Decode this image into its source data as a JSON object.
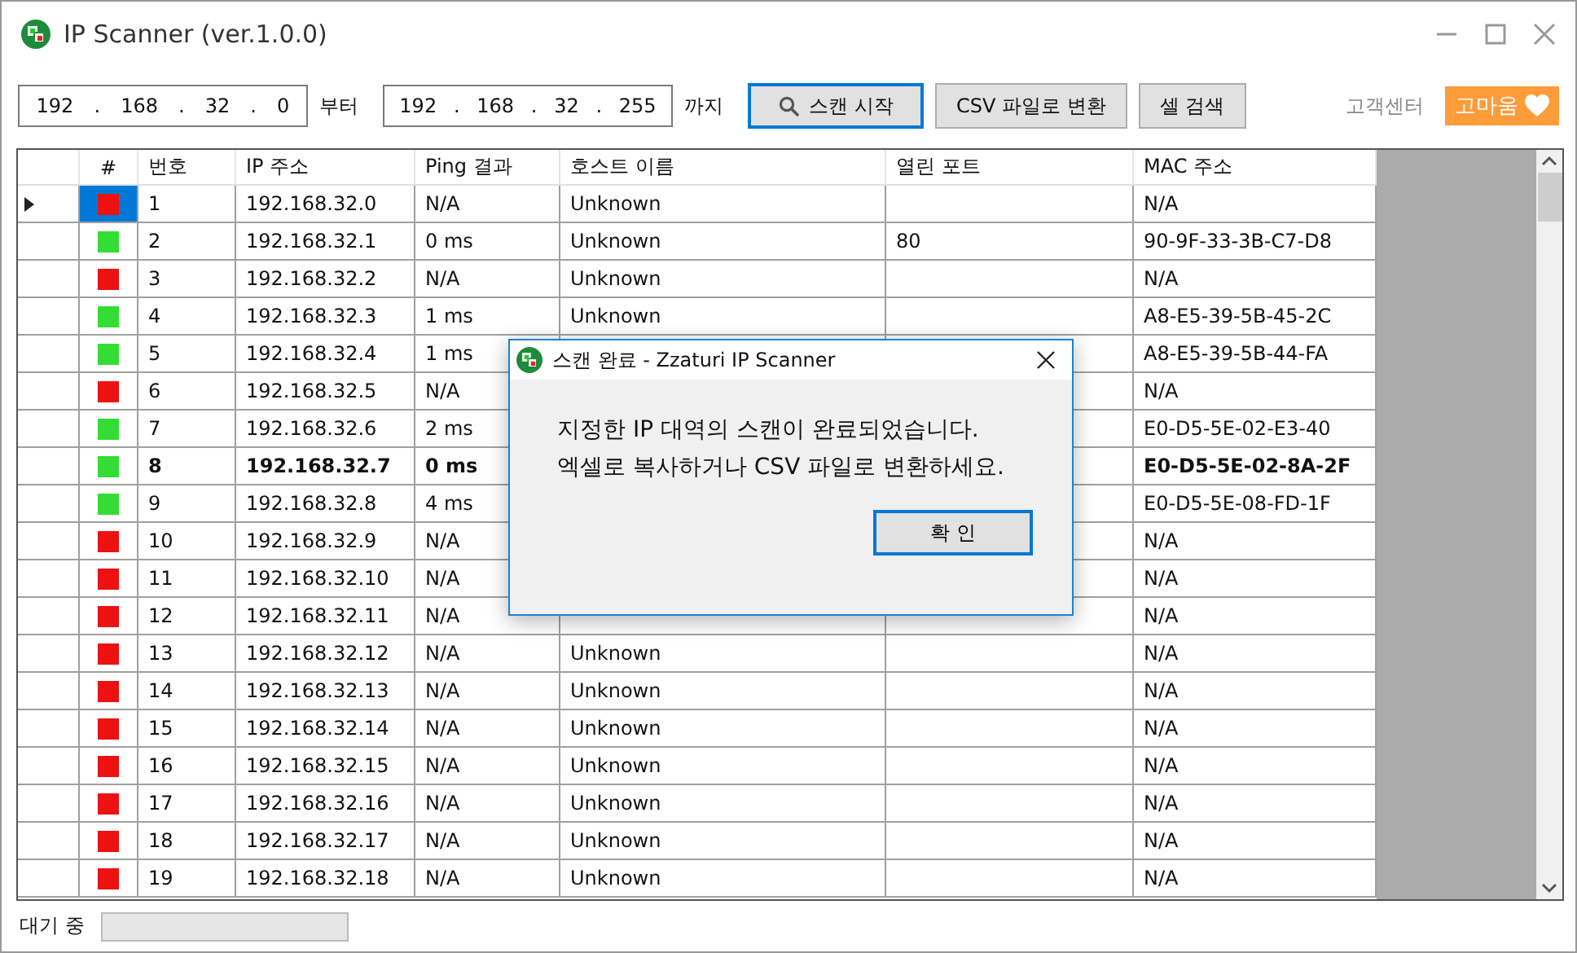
{
  "window": {
    "title": "IP Scanner (ver.1.0.0)"
  },
  "toolbar": {
    "range_start": {
      "octets": [
        "192",
        "168",
        "32",
        "0"
      ],
      "separator": "."
    },
    "start_suffix": "부터",
    "range_end": {
      "octets": [
        "192",
        "168",
        "32",
        "255"
      ],
      "separator": "."
    },
    "end_suffix": "까지",
    "buttons": [
      {
        "label": "스캔 시작",
        "kind": "search",
        "focused": true
      },
      {
        "label": "CSV 파일로 변환",
        "kind": "plain",
        "focused": false
      },
      {
        "label": "셀 검색",
        "kind": "plain",
        "focused": false
      }
    ],
    "support_link": "고객센터",
    "thanks_button": "고마움"
  },
  "table": {
    "columns": [
      "#",
      "번호",
      "IP 주소",
      "Ping 결과",
      "호스트 이름",
      "열린 포트",
      "MAC 주소"
    ],
    "rows": [
      {
        "selected": true,
        "bold": false,
        "color": "#ee1111",
        "number": "1",
        "ip": "192.168.32.0",
        "ping": "N/A",
        "host": "Unknown",
        "mac": "N/A"
      },
      {
        "selected": false,
        "bold": false,
        "color": "#33dd33",
        "number": "2",
        "ip": "192.168.32.1",
        "ping": "0 ms",
        "host": "Unknown",
        "port": "80",
        "mac": "90-9F-33-3B-C7-D8"
      },
      {
        "selected": false,
        "bold": false,
        "color": "#ee1111",
        "number": "3",
        "ip": "192.168.32.2",
        "ping": "N/A",
        "host": "Unknown",
        "mac": "N/A"
      },
      {
        "selected": false,
        "bold": false,
        "color": "#33dd33",
        "number": "4",
        "ip": "192.168.32.3",
        "ping": "1 ms",
        "host": "Unknown",
        "mac": "A8-E5-39-5B-45-2C"
      },
      {
        "selected": false,
        "bold": false,
        "color": "#33dd33",
        "number": "5",
        "ip": "192.168.32.4",
        "ping": "1 ms",
        "mac": "A8-E5-39-5B-44-FA"
      },
      {
        "selected": false,
        "bold": false,
        "color": "#ee1111",
        "number": "6",
        "ip": "192.168.32.5",
        "ping": "N/A",
        "mac": "N/A"
      },
      {
        "selected": false,
        "bold": false,
        "color": "#33dd33",
        "number": "7",
        "ip": "192.168.32.6",
        "ping": "2 ms",
        "mac": "E0-D5-5E-02-E3-40"
      },
      {
        "selected": false,
        "bold": true,
        "color": "#33dd33",
        "number": "8",
        "ip": "192.168.32.7",
        "ping": "0 ms",
        "mac": "E0-D5-5E-02-8A-2F"
      },
      {
        "selected": false,
        "bold": false,
        "color": "#33dd33",
        "number": "9",
        "ip": "192.168.32.8",
        "ping": "4 ms",
        "mac": "E0-D5-5E-08-FD-1F"
      },
      {
        "selected": false,
        "bold": false,
        "color": "#ee1111",
        "number": "10",
        "ip": "192.168.32.9",
        "ping": "N/A",
        "mac": "N/A"
      },
      {
        "selected": false,
        "bold": false,
        "color": "#ee1111",
        "number": "11",
        "ip": "192.168.32.10",
        "ping": "N/A",
        "mac": "N/A"
      },
      {
        "selected": false,
        "bold": false,
        "color": "#ee1111",
        "number": "12",
        "ip": "192.168.32.11",
        "ping": "N/A",
        "mac": "N/A"
      },
      {
        "selected": false,
        "bold": false,
        "color": "#ee1111",
        "number": "13",
        "ip": "192.168.32.12",
        "ping": "N/A",
        "host": "Unknown",
        "mac": "N/A"
      },
      {
        "selected": false,
        "bold": false,
        "color": "#ee1111",
        "number": "14",
        "ip": "192.168.32.13",
        "ping": "N/A",
        "host": "Unknown",
        "mac": "N/A"
      },
      {
        "selected": false,
        "bold": false,
        "color": "#ee1111",
        "number": "15",
        "ip": "192.168.32.14",
        "ping": "N/A",
        "host": "Unknown",
        "mac": "N/A"
      },
      {
        "selected": false,
        "bold": false,
        "color": "#ee1111",
        "number": "16",
        "ip": "192.168.32.15",
        "ping": "N/A",
        "host": "Unknown",
        "mac": "N/A"
      },
      {
        "selected": false,
        "bold": false,
        "color": "#ee1111",
        "number": "17",
        "ip": "192.168.32.16",
        "ping": "N/A",
        "host": "Unknown",
        "mac": "N/A"
      },
      {
        "selected": false,
        "bold": false,
        "color": "#ee1111",
        "number": "18",
        "ip": "192.168.32.17",
        "ping": "N/A",
        "host": "Unknown",
        "mac": "N/A"
      },
      {
        "selected": false,
        "bold": false,
        "color": "#ee1111",
        "number": "19",
        "ip": "192.168.32.18",
        "ping": "N/A",
        "host": "Unknown",
        "mac": "N/A"
      }
    ]
  },
  "dialog": {
    "title": "스캔 완료 - Zzaturi IP Scanner",
    "lines": [
      "지정한 IP 대역의 스캔이 완료되었습니다.",
      "엑셀로 복사하거나 CSV 파일로 변환하세요."
    ],
    "button": "확 인"
  },
  "status_bar": {
    "text": "대기 중",
    "progress": {
      "level": 0
    }
  }
}
